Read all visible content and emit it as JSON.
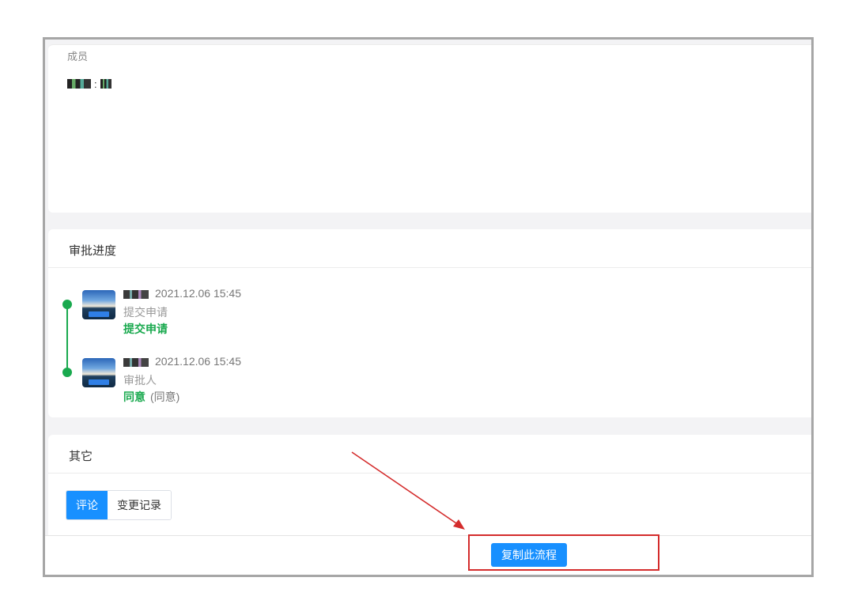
{
  "members": {
    "label": "成员",
    "value_separator": ":"
  },
  "approval": {
    "title": "审批进度",
    "entries": [
      {
        "time": "2021.12.06 15:45",
        "role": "提交申请",
        "result": "提交申请",
        "note": ""
      },
      {
        "time": "2021.12.06 15:45",
        "role": "审批人",
        "result": "同意",
        "note": "(同意)"
      }
    ]
  },
  "other": {
    "title": "其它",
    "tabs": [
      {
        "label": "评论",
        "active": true
      },
      {
        "label": "变更记录",
        "active": false
      }
    ]
  },
  "footer": {
    "copy_button_label": "复制此流程"
  },
  "colors": {
    "primary": "#1890ff",
    "success": "#19a94e",
    "annotation": "#d42c2c"
  },
  "icons": {
    "timeline_dot": "circle-dot",
    "avatar": "user-avatar-image"
  }
}
